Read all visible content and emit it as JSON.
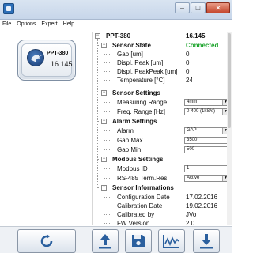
{
  "window": {
    "icon": "app-icon",
    "controls": {
      "minimize": "–",
      "maximize": "□",
      "close": "✕"
    }
  },
  "menu": {
    "items": [
      "File",
      "Options",
      "Expert",
      "Help"
    ]
  },
  "device": {
    "name": "PPT-380",
    "value": "16.145",
    "logo_icon": "eagle-logo-icon"
  },
  "tree": {
    "root": {
      "label": "PPT-380",
      "value": "16.145"
    },
    "sensor_state": {
      "label": "Sensor State",
      "value": "Connected",
      "status_color": "#1aa32a",
      "items": [
        {
          "label": "Gap [um]",
          "value": "0"
        },
        {
          "label": "Displ. Peak [um]",
          "value": "0"
        },
        {
          "label": "Displ. PeakPeak [um]",
          "value": "0"
        },
        {
          "label": "Temperature [°C]",
          "value": "24"
        }
      ]
    },
    "sensor_settings": {
      "label": "Sensor Settings",
      "measuring_range": {
        "label": "Measuring Range",
        "value": "4mm"
      },
      "freq_range": {
        "label": "Freq. Range [Hz]",
        "value": "0-400 (1kS/s)"
      }
    },
    "alarm_settings": {
      "label": "Alarm Settings",
      "alarm": {
        "label": "Alarm",
        "value": "GAP"
      },
      "gap_max": {
        "label": "Gap Max",
        "value": "3500"
      },
      "gap_min": {
        "label": "Gap Min",
        "value": "500"
      }
    },
    "modbus_settings": {
      "label": "Modbus Settings",
      "modbus_id": {
        "label": "Modbus ID",
        "value": "1"
      },
      "rs485": {
        "label": "RS-485 Term.Res.",
        "value": "Active"
      }
    },
    "sensor_informations": {
      "label": "Sensor Informations",
      "items": [
        {
          "label": "Configuration Date",
          "value": "17.02.2016"
        },
        {
          "label": "Calibration Date",
          "value": "19.02.2016"
        },
        {
          "label": "Calibrated by",
          "value": "JVo"
        },
        {
          "label": "FW Version",
          "value": "2.0"
        }
      ]
    }
  },
  "toolbar": {
    "buttons": [
      {
        "icon": "refresh-icon"
      },
      {
        "icon": "upload-icon"
      },
      {
        "icon": "save-icon"
      },
      {
        "icon": "waveform-chart-icon"
      },
      {
        "icon": "download-icon"
      }
    ]
  }
}
